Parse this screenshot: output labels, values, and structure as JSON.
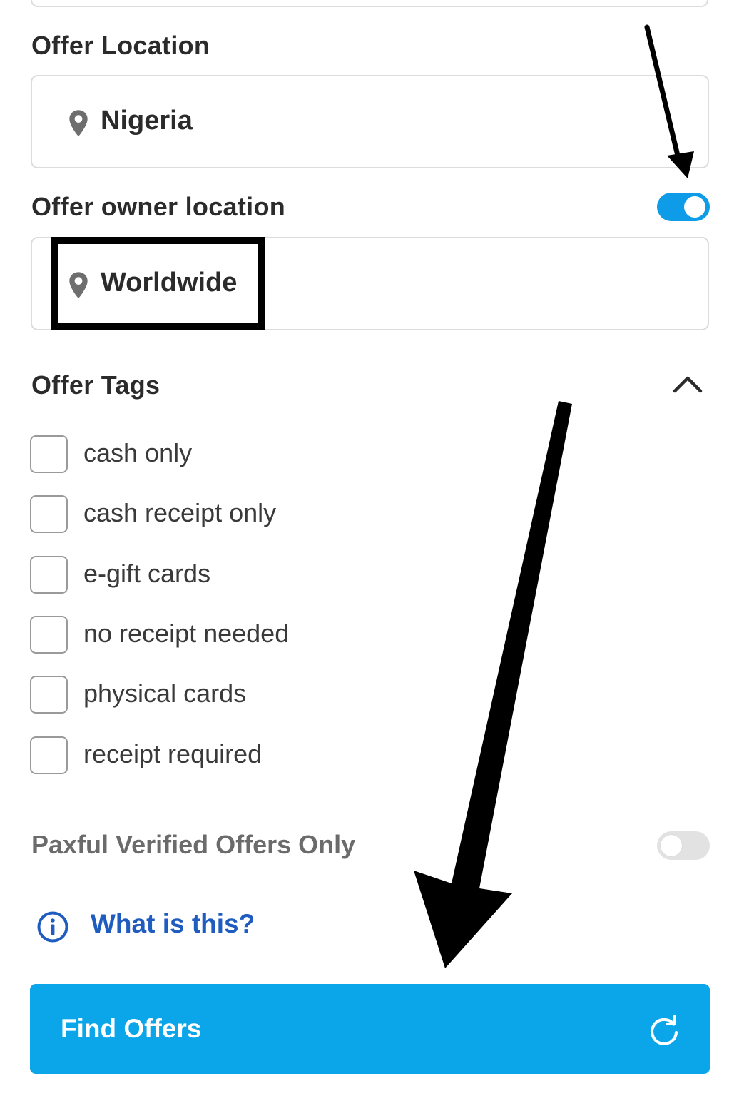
{
  "offer_location": {
    "label": "Offer Location",
    "value": "Nigeria",
    "icon": "map-pin-icon"
  },
  "owner_location": {
    "label": "Offer owner location",
    "value": "Worldwide",
    "toggle_on": true,
    "icon": "map-pin-icon"
  },
  "offer_tags": {
    "label": "Offer Tags",
    "expanded": true,
    "items": [
      {
        "label": "cash only",
        "checked": false
      },
      {
        "label": "cash receipt only",
        "checked": false
      },
      {
        "label": "e-gift cards",
        "checked": false
      },
      {
        "label": "no receipt needed",
        "checked": false
      },
      {
        "label": "physical cards",
        "checked": false
      },
      {
        "label": "receipt required",
        "checked": false
      }
    ]
  },
  "verified_offers": {
    "label": "Paxful Verified Offers Only",
    "toggle_on": false
  },
  "help": {
    "label": "What is this?",
    "icon": "info-icon"
  },
  "find_button": {
    "label": "Find Offers",
    "icon": "refresh-icon"
  },
  "colors": {
    "accent": "#0ba6ea",
    "toggle_on": "#0e9be8",
    "link": "#1f5cbf",
    "annotation": "#000000"
  }
}
